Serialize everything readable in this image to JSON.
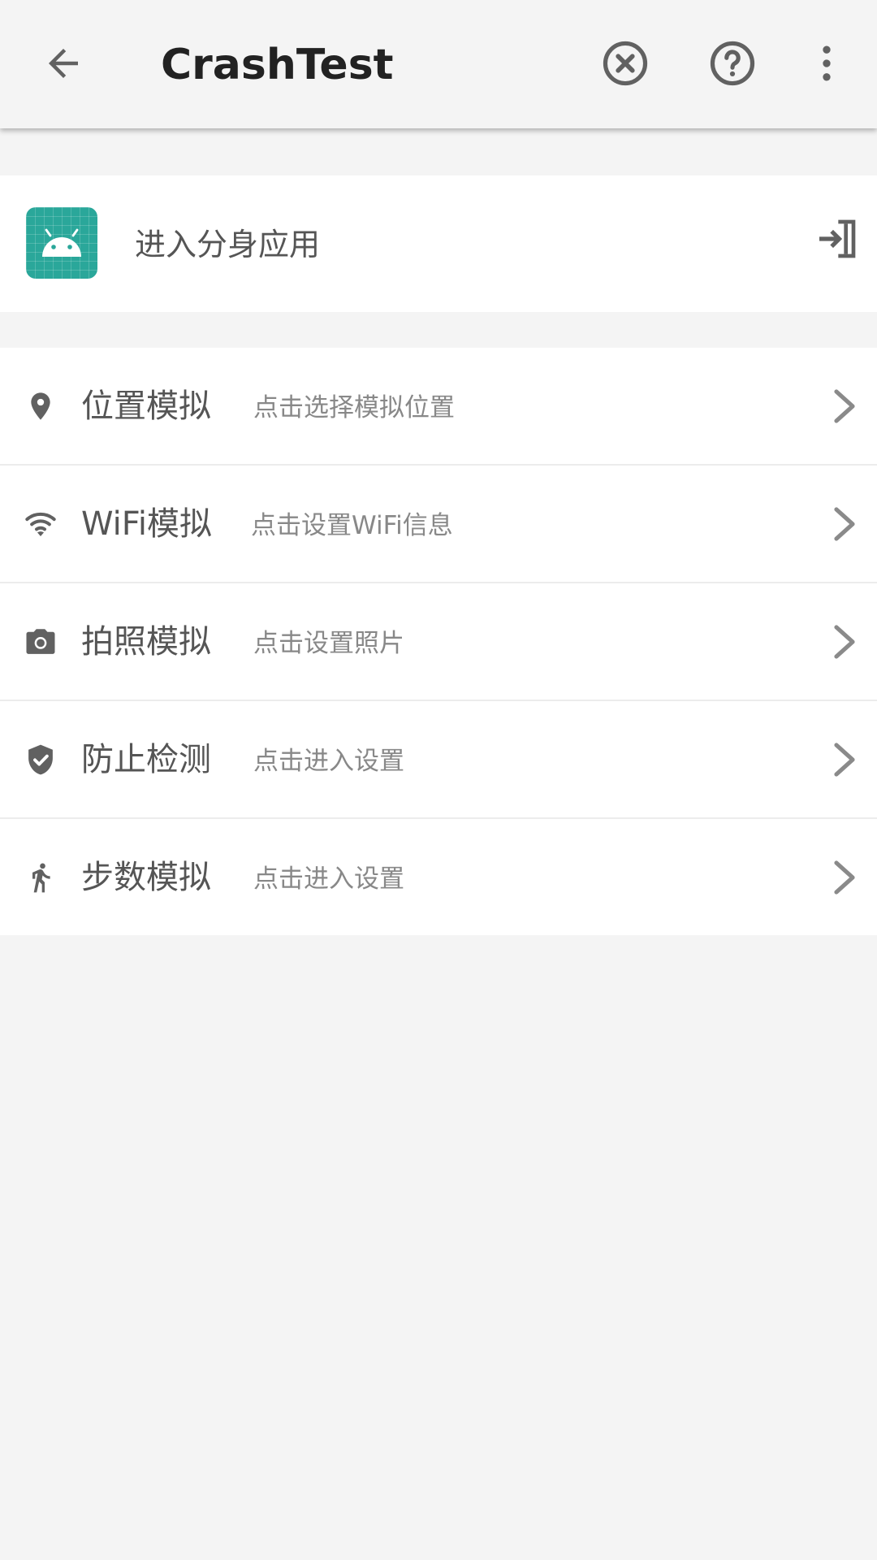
{
  "header": {
    "title": "CrashTest",
    "icons": [
      "arrow-back-icon",
      "close-circle-icon",
      "help-circle-icon",
      "more-vert-icon"
    ]
  },
  "clone": {
    "label": "进入分身应用",
    "app_icon": "android-app-icon",
    "action_icon": "enter-app-icon"
  },
  "items": [
    {
      "icon": "location-pin-icon",
      "title": "位置模拟",
      "subtitle": "点击选择模拟位置"
    },
    {
      "icon": "wifi-icon",
      "title": "WiFi模拟",
      "subtitle": "点击设置WiFi信息"
    },
    {
      "icon": "camera-icon",
      "title": "拍照模拟",
      "subtitle": "点击设置照片"
    },
    {
      "icon": "shield-check-icon",
      "title": "防止检测",
      "subtitle": "点击进入设置"
    },
    {
      "icon": "walk-icon",
      "title": "步数模拟",
      "subtitle": "点击进入设置"
    }
  ],
  "colors": {
    "background": "#f4f4f4",
    "card": "#ffffff",
    "icon_gray": "#616161",
    "app_teal": "#2aa79a",
    "title_text": "#222222",
    "subtitle_text": "#888888"
  }
}
